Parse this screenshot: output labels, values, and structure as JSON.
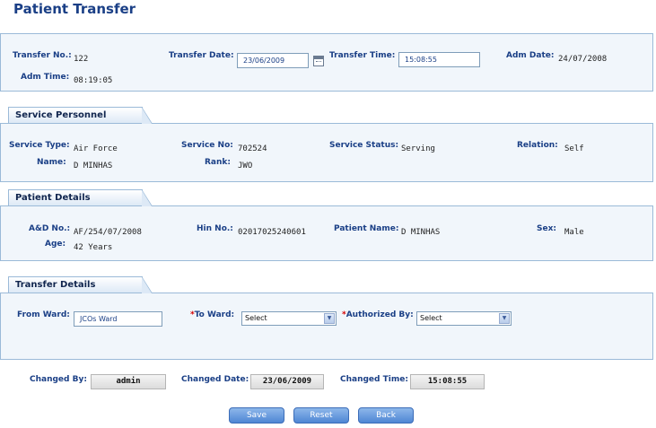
{
  "page": {
    "title": "Patient Transfer"
  },
  "transfer": {
    "no_label": "Transfer No.:",
    "no_value": "122",
    "date_label": "Transfer Date:",
    "date_value": "23/06/2009",
    "time_label": "Transfer Time:",
    "time_value": "15:08:55",
    "adm_date_label": "Adm Date:",
    "adm_date_value": "24/07/2008",
    "adm_time_label": "Adm Time:",
    "adm_time_value": "08:19:05"
  },
  "service": {
    "header": "Service Personnel Details",
    "type_label": "Service Type:",
    "type_value": "Air Force",
    "no_label": "Service No:",
    "no_value": "702524",
    "status_label": "Service Status:",
    "status_value": "Serving",
    "relation_label": "Relation:",
    "relation_value": "Self",
    "name_label": "Name:",
    "name_value": "D MINHAS",
    "rank_label": "Rank:",
    "rank_value": "JWO"
  },
  "patient": {
    "header": "Patient Details",
    "ad_label": "A&D No.:",
    "ad_value": "AF/254/07/2008",
    "hin_label": "Hin No.:",
    "hin_value": "02017025240601",
    "name_label": "Patient Name:",
    "name_value": "D MINHAS",
    "sex_label": "Sex:",
    "sex_value": "Male",
    "age_label": "Age:",
    "age_value": "42 Years"
  },
  "transfer_details": {
    "header": "Transfer Details",
    "from_label": "From Ward:",
    "from_value": "JCOs Ward",
    "to_label": "To Ward:",
    "to_value": "Select",
    "auth_label": "Authorized By:",
    "auth_value": "Select",
    "required_mark": "*"
  },
  "footer": {
    "changed_by_label": "Changed By:",
    "changed_by_value": "admin",
    "changed_date_label": "Changed Date:",
    "changed_date_value": "23/06/2009",
    "changed_time_label": "Changed Time:",
    "changed_time_value": "15:08:55"
  },
  "buttons": {
    "save": "Save",
    "reset": "Reset",
    "back": "Back"
  },
  "icons": {
    "calendar": "calendar-icon",
    "dropdown": "chevron-down-icon"
  },
  "colors": {
    "label": "#1a3f86",
    "panel_bg": "#f1f6fb",
    "panel_border": "#9bbad8",
    "button": "#5b8fd8",
    "required": "#d40000"
  }
}
